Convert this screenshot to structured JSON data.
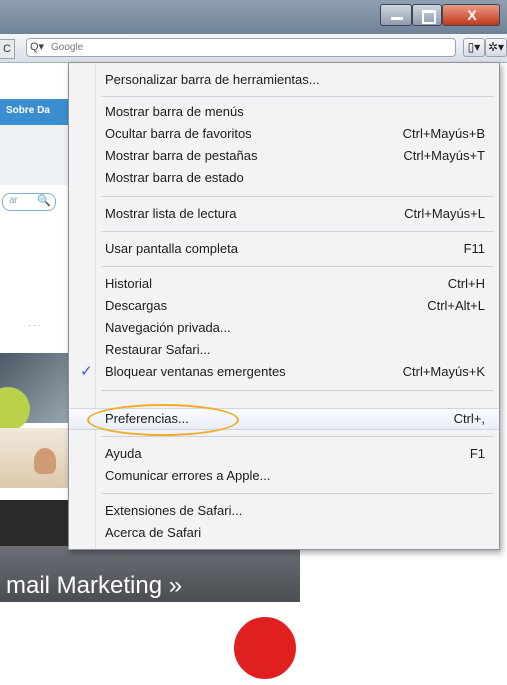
{
  "toolbar": {
    "search_placeholder": "Google",
    "reload_glyph": "C",
    "search_icon_glyph": "Q▾",
    "page_menu_glyph": "▯▾",
    "settings_menu_glyph": "✲▾"
  },
  "window": {
    "close_glyph": "X"
  },
  "webpage": {
    "tab_label": "Sobre Da",
    "search_text": "ar",
    "search_glyph": "🔍",
    "strip_text": "· · ·",
    "footer_text": "mail Marketing »"
  },
  "menu": {
    "items": [
      {
        "label": "Personalizar barra de herramientas...",
        "shortcut": ""
      },
      {
        "label": "Mostrar barra de menús",
        "shortcut": ""
      },
      {
        "label": "Ocultar barra de favoritos",
        "shortcut": "Ctrl+Mayús+B"
      },
      {
        "label": "Mostrar barra de pestañas",
        "shortcut": "Ctrl+Mayús+T"
      },
      {
        "label": "Mostrar barra de estado",
        "shortcut": ""
      },
      {
        "label": "Mostrar lista de lectura",
        "shortcut": "Ctrl+Mayús+L"
      },
      {
        "label": "Usar pantalla completa",
        "shortcut": "F11"
      },
      {
        "label": "Historial",
        "shortcut": "Ctrl+H"
      },
      {
        "label": "Descargas",
        "shortcut": "Ctrl+Alt+L"
      },
      {
        "label": "Navegación privada...",
        "shortcut": ""
      },
      {
        "label": "Restaurar Safari...",
        "shortcut": ""
      },
      {
        "label": "Bloquear ventanas emergentes",
        "shortcut": "Ctrl+Mayús+K",
        "checked": true
      },
      {
        "label": "Preferencias...",
        "shortcut": "Ctrl+,",
        "highlighted": true
      },
      {
        "label": "Ayuda",
        "shortcut": "F1"
      },
      {
        "label": "Comunicar errores a Apple...",
        "shortcut": ""
      },
      {
        "label": "Extensiones de Safari...",
        "shortcut": ""
      },
      {
        "label": "Acerca de Safari",
        "shortcut": ""
      }
    ],
    "check_glyph": "✓",
    "highlight_color": "#f2ab2a"
  }
}
